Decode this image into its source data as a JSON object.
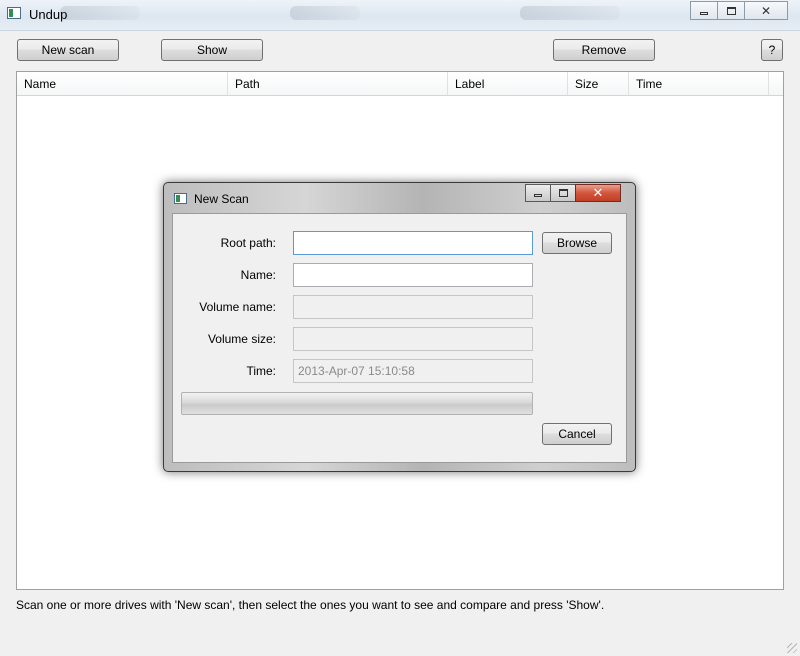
{
  "window": {
    "title": "Undup"
  },
  "toolbar": {
    "new_scan_label": "New scan",
    "show_label": "Show",
    "remove_label": "Remove",
    "help_label": "?"
  },
  "table": {
    "columns": [
      "Name",
      "Path",
      "Label",
      "Size",
      "Time"
    ],
    "rows": []
  },
  "status": {
    "text": "Scan one or more drives with 'New scan', then select the ones you want to see and compare and press 'Show'."
  },
  "dialog": {
    "title": "New Scan",
    "root_path_label": "Root path:",
    "root_path_value": "",
    "name_label": "Name:",
    "name_value": "",
    "volume_name_label": "Volume name:",
    "volume_name_value": "",
    "volume_size_label": "Volume size:",
    "volume_size_value": "",
    "time_label": "Time:",
    "time_value": "2013-Apr-07 15:10:58",
    "browse_label": "Browse",
    "cancel_label": "Cancel",
    "progress_fraction": 0
  },
  "icons": {
    "app": "app-window-icon",
    "minimize": "minimize-icon",
    "maximize": "maximize-icon",
    "close": "close-icon"
  }
}
